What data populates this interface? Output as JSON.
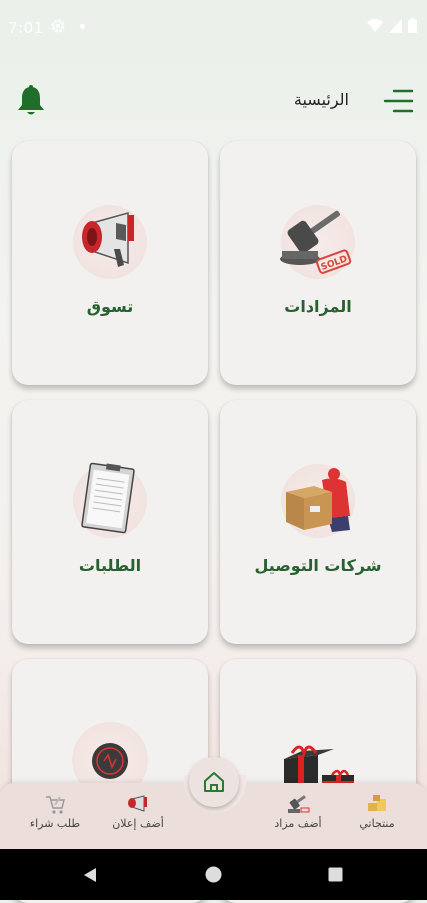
{
  "status": {
    "time": "7:01"
  },
  "header": {
    "title": "الرئيسية"
  },
  "cards": [
    {
      "label": "المزادات",
      "icon": "gavel-icon"
    },
    {
      "label": "تسوق",
      "icon": "megaphone-icon"
    },
    {
      "label": "شركات التوصيل",
      "icon": "delivery-box-icon"
    },
    {
      "label": "الطلبات",
      "icon": "clipboard-icon"
    },
    {
      "label": "",
      "icon": "gift-boxes-icon"
    },
    {
      "label": "",
      "icon": "round-badge-icon"
    }
  ],
  "bottom_nav": {
    "items": [
      {
        "label": "منتجاتي",
        "icon": "products-icon"
      },
      {
        "label": "أضف مزاد",
        "icon": "add-auction-icon"
      },
      {
        "label": "أضف إعلان",
        "icon": "add-ad-icon"
      },
      {
        "label": "طلب شراء",
        "icon": "purchase-request-icon"
      }
    ],
    "center": "home-icon"
  },
  "colors": {
    "accent": "#26612f",
    "sold_stamp": "#d9453a",
    "bell": "#1f6e2a"
  }
}
